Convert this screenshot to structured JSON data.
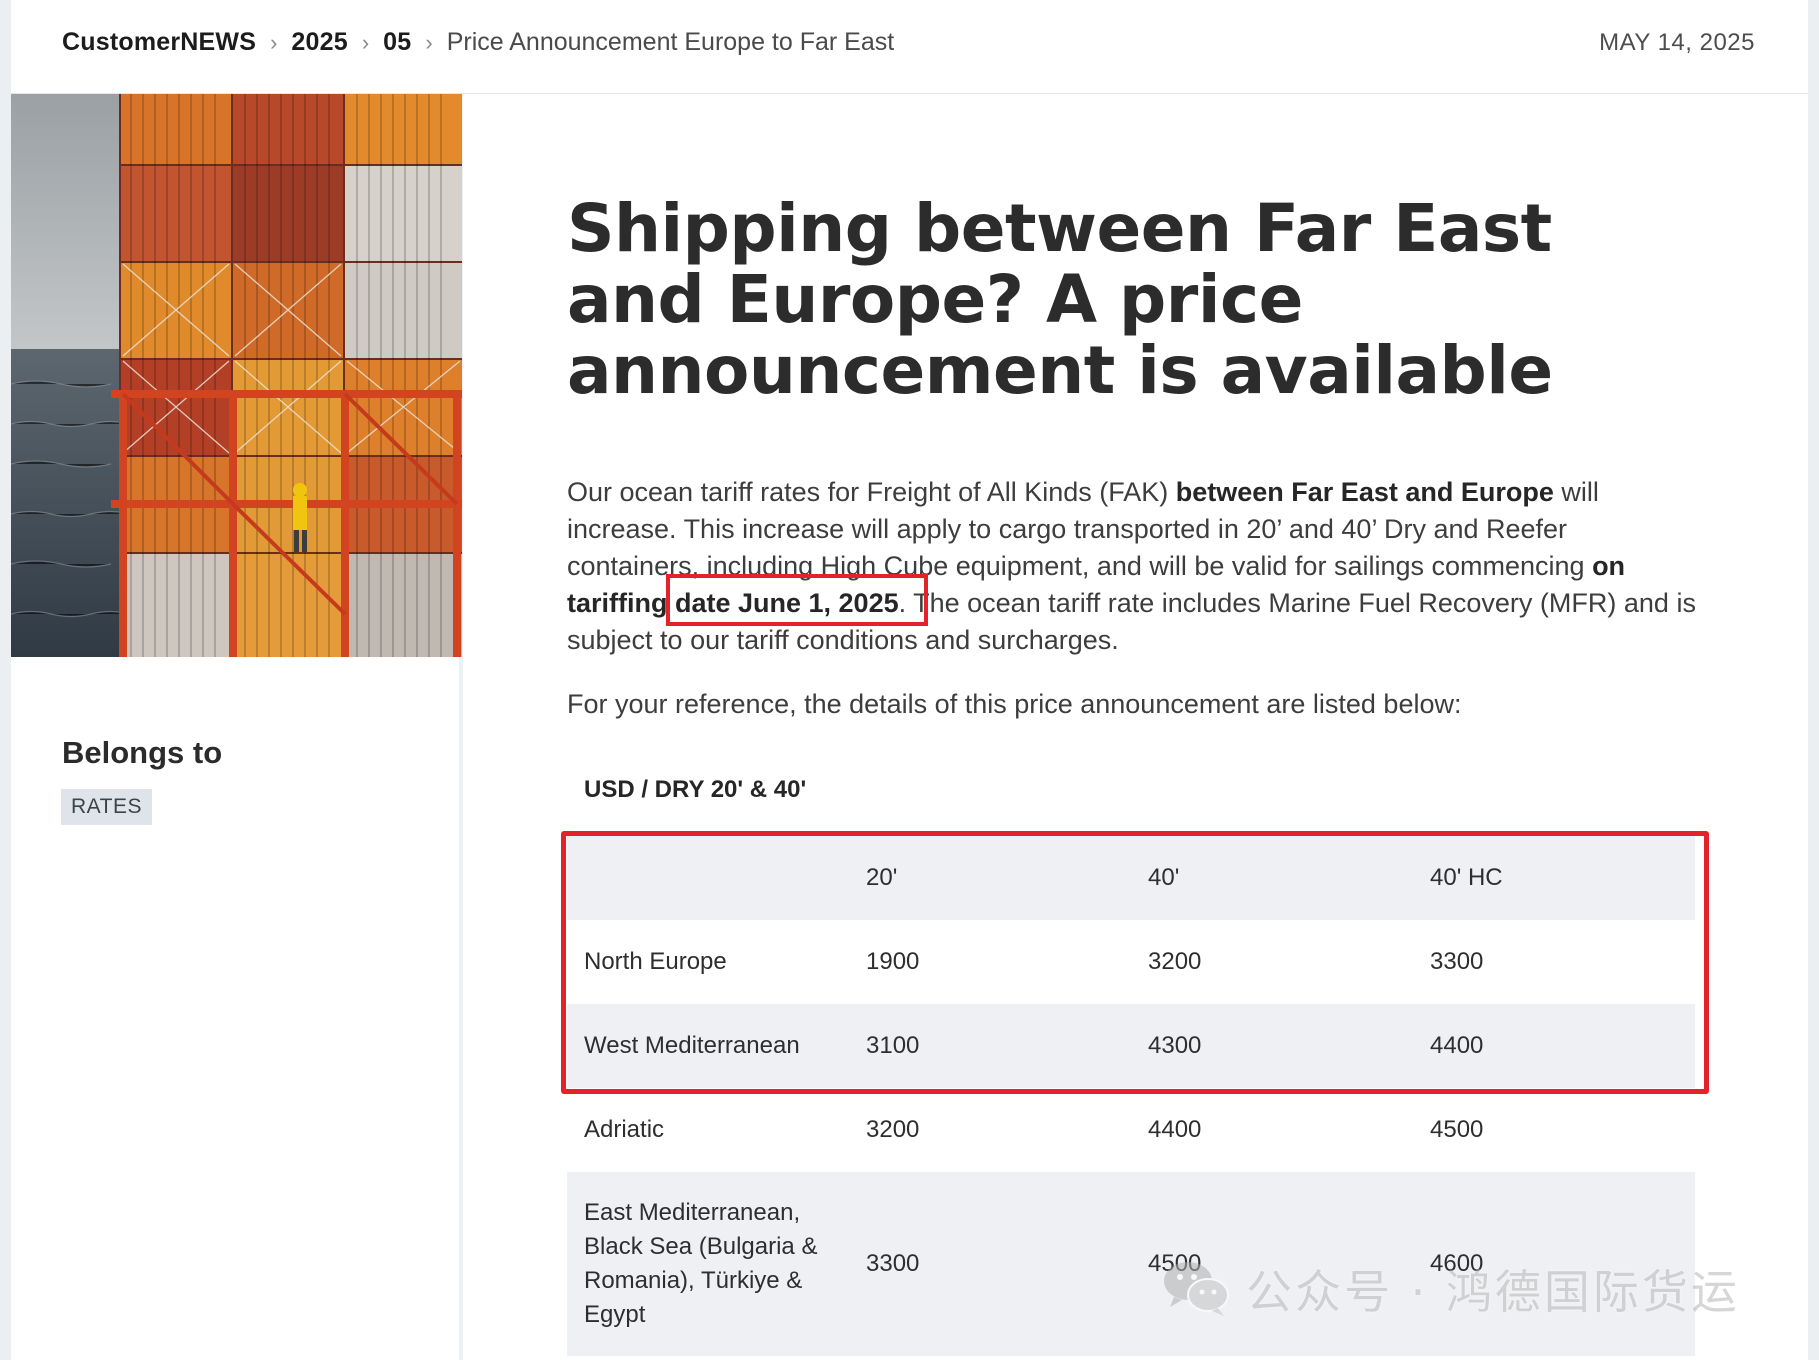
{
  "header": {
    "breadcrumb": [
      {
        "label": "CustomerNEWS"
      },
      {
        "label": "2025"
      },
      {
        "label": "05"
      },
      {
        "label": "Price Announcement Europe to Far East"
      }
    ],
    "date": "MAY 14, 2025"
  },
  "sidebar": {
    "belongs_label": "Belongs to",
    "tag": "RATES"
  },
  "article": {
    "title": "Shipping between Far East and Europe? A price announcement is available",
    "para1": {
      "t1": "Our ocean tariff rates for Freight of All Kinds (FAK) ",
      "b1": "between Far East and Europe",
      "t2": " will increase. This increase will apply to cargo transported in 20’ and 40’ Dry and Reefer containers, including High Cube equipment, and will be valid for sailings commencing ",
      "b2": "on tariffing date June 1, 2025",
      "t3": ". The ocean tariff rate includes Marine Fuel Recovery (MFR) and is subject to our tariff conditions and surcharges."
    },
    "para2": "For your reference, the details of this price announcement are listed below:",
    "table_caption": "USD / DRY 20' & 40'",
    "table": {
      "headers": [
        "",
        "20'",
        "40'",
        "40' HC"
      ],
      "rows": [
        {
          "region": "North Europe",
          "v20": "1900",
          "v40": "3200",
          "v40hc": "3300"
        },
        {
          "region": "West Mediterranean",
          "v20": "3100",
          "v40": "4300",
          "v40hc": "4400"
        },
        {
          "region": "Adriatic",
          "v20": "3200",
          "v40": "4400",
          "v40hc": "4500"
        },
        {
          "region": "East Mediterranean, Black Sea (Bulgaria & Romania), Türkiye & Egypt",
          "v20": "3300",
          "v40": "4500",
          "v40hc": "4600"
        }
      ]
    }
  },
  "watermark": {
    "icon": "wechat-icon",
    "text": "公众号 · 鸿德国际货运"
  },
  "colors": {
    "highlight_border": "#e3222a",
    "table_shade": "#eef0f3",
    "tag_bg": "#dfe4ea"
  }
}
